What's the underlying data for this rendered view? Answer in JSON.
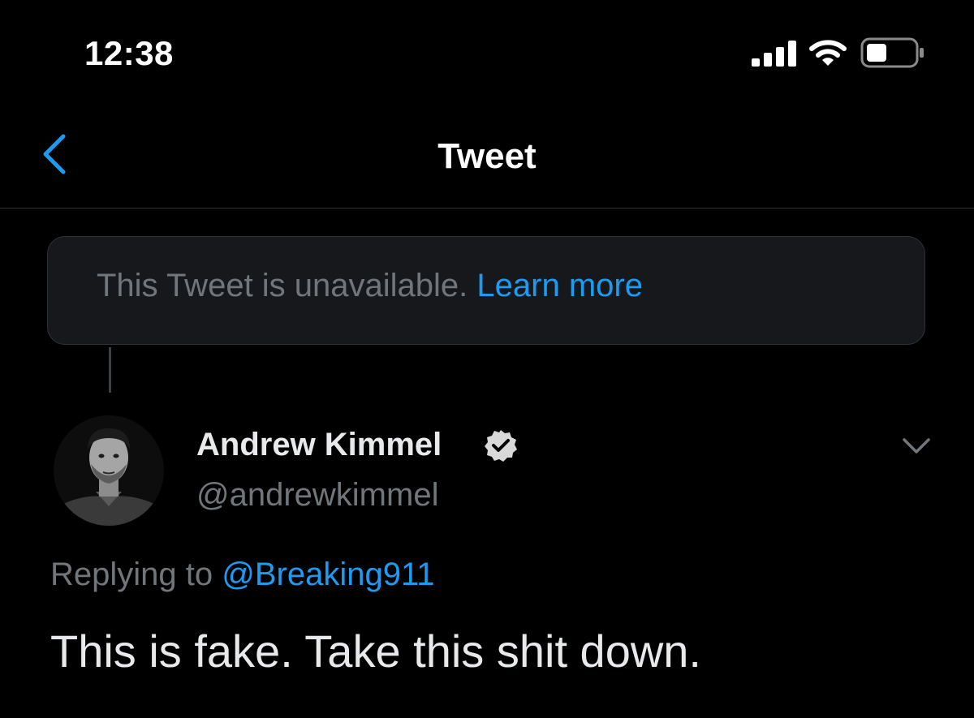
{
  "status_bar": {
    "time": "12:38",
    "icons": [
      "signal-icon",
      "wifi-icon",
      "battery-icon"
    ]
  },
  "header": {
    "title": "Tweet",
    "back_icon": "chevron-left-icon"
  },
  "unavailable_notice": {
    "text": "This Tweet is unavailable.",
    "link_label": "Learn more"
  },
  "tweet": {
    "author_name": "Andrew Kimmel",
    "author_handle": "@andrewkimmel",
    "verified": true,
    "replying_prefix": "Replying to",
    "replying_handle": "@Breaking911",
    "text": "This is fake. Take this shit down."
  },
  "colors": {
    "background": "#000000",
    "accent": "#1d9bf0",
    "muted": "#71767b",
    "text": "#e7e9ea"
  }
}
